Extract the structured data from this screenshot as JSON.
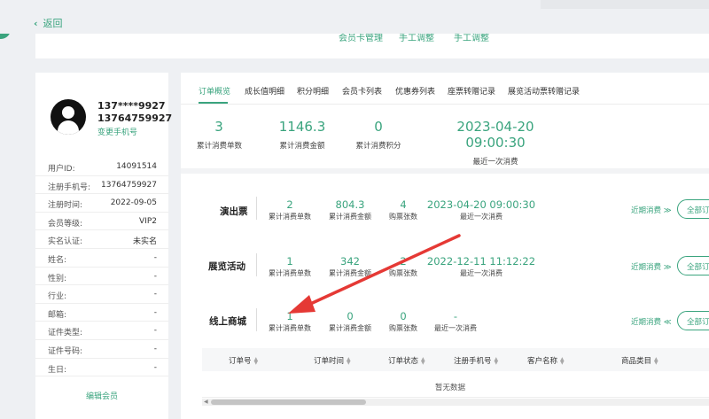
{
  "nav": {
    "back_label": "返回"
  },
  "shortcuts": [
    "会员卡管理",
    "手工调整",
    "手工调整"
  ],
  "profile": {
    "masked_phone": "137****9927",
    "phone": "13764759927",
    "change_phone_label": "变更手机号",
    "fields": [
      {
        "label": "用户ID:",
        "value": "14091514"
      },
      {
        "label": "注册手机号:",
        "value": "13764759927"
      },
      {
        "label": "注册时间:",
        "value": "2022-09-05"
      },
      {
        "label": "会员等级:",
        "value": "VIP2"
      },
      {
        "label": "实名认证:",
        "value": "未实名"
      },
      {
        "label": "姓名:",
        "value": "-"
      },
      {
        "label": "性别:",
        "value": "-"
      },
      {
        "label": "行业:",
        "value": "-"
      },
      {
        "label": "邮箱:",
        "value": "-"
      },
      {
        "label": "证件类型:",
        "value": "-"
      },
      {
        "label": "证件号码:",
        "value": "-"
      },
      {
        "label": "生日:",
        "value": "-"
      }
    ],
    "edit_label": "编辑会员"
  },
  "tabs": [
    "订单概览",
    "成长值明细",
    "积分明细",
    "会员卡列表",
    "优惠券列表",
    "座票转赠记录",
    "展览活动票转赠记录"
  ],
  "summary": [
    {
      "value": "3",
      "label": "累计消费单数"
    },
    {
      "value": "1146.3",
      "label": "累计消费金额"
    },
    {
      "value": "0",
      "label": "累计消费积分"
    },
    {
      "value": "2023-04-20 09:00:30",
      "label": "最近一次消费"
    }
  ],
  "categories": [
    {
      "name": "演出票",
      "stats": [
        {
          "value": "2",
          "label": "累计消费单数"
        },
        {
          "value": "804.3",
          "label": "累计消费金额"
        },
        {
          "value": "4",
          "label": "购票张数"
        },
        {
          "value": "2023-04-20 09:00:30",
          "label": "最近一次消费"
        }
      ],
      "recent_label": "近期消费 ≫",
      "all_label": "全部订"
    },
    {
      "name": "展览活动",
      "stats": [
        {
          "value": "1",
          "label": "累计消费单数"
        },
        {
          "value": "342",
          "label": "累计消费金额"
        },
        {
          "value": "2",
          "label": "购票张数"
        },
        {
          "value": "2022-12-11 11:12:22",
          "label": "最近一次消费"
        }
      ],
      "recent_label": "近期消费 ≫",
      "all_label": "全部订"
    },
    {
      "name": "线上商城",
      "stats": [
        {
          "value": "1",
          "label": "累计消费单数"
        },
        {
          "value": "0",
          "label": "累计消费金额"
        },
        {
          "value": "0",
          "label": "购票张数"
        },
        {
          "value": "-",
          "label": "最近一次消费"
        }
      ],
      "recent_label": "近期消费 ≪",
      "all_label": "全部订"
    }
  ],
  "table": {
    "columns": [
      "订单号",
      "订单时间",
      "订单状态",
      "注册手机号",
      "客户名称",
      "商品类目"
    ],
    "empty_text": "暂无数据"
  },
  "colors": {
    "accent": "#3aa47e",
    "annotation_arrow": "#e53935"
  }
}
